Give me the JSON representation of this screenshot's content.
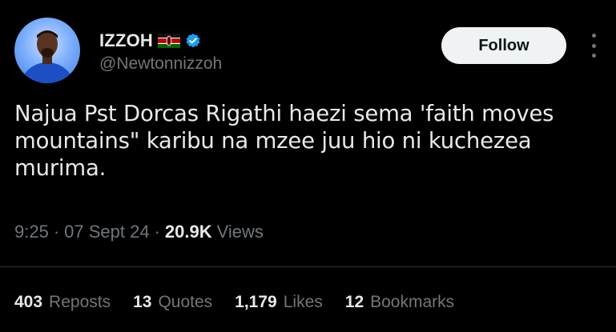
{
  "author": {
    "name": "IZZOH",
    "handle": "@Newtonnizzoh",
    "flag_icon": "kenya-flag-icon",
    "verified_icon": "verified-badge-icon"
  },
  "actions": {
    "follow_label": "Follow",
    "more_icon": "more-vertical-icon"
  },
  "tweet": {
    "text": "Najua Pst Dorcas Rigathi haezi sema 'faith moves mountains\" karibu na mzee juu hio ni kuchezea murima.",
    "time": "9:25",
    "date": "07 Sept 24",
    "views_count": "20.9K",
    "views_label": "Views",
    "separator": "·"
  },
  "stats": [
    {
      "count": "403",
      "label": "Reposts"
    },
    {
      "count": "13",
      "label": "Quotes"
    },
    {
      "count": "1,179",
      "label": "Likes"
    },
    {
      "count": "12",
      "label": "Bookmarks"
    }
  ],
  "colors": {
    "background": "#000000",
    "text": "#e7e9ea",
    "secondary": "#71767b",
    "verified": "#1d9bf0",
    "follow_bg": "#eff3f4"
  }
}
